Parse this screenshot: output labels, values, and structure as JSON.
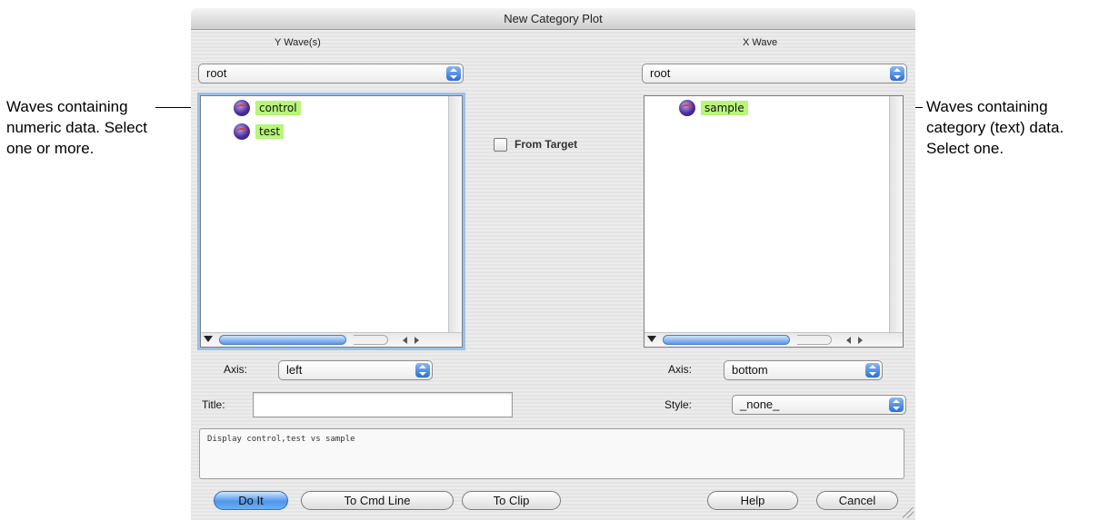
{
  "annotations": {
    "left_lines": [
      "Waves containing",
      "numeric data. Select",
      "one or more."
    ],
    "right_lines": [
      "Waves containing",
      "category (text) data.",
      "Select one."
    ]
  },
  "dialog": {
    "title": "New Category Plot",
    "y_panel": {
      "label": "Y Wave(s)",
      "folder": "root",
      "waves": [
        "control",
        "test"
      ],
      "axis_label": "Axis:",
      "axis_value": "left"
    },
    "x_panel": {
      "label": "X Wave",
      "folder": "root",
      "waves": [
        "sample"
      ],
      "axis_label": "Axis:",
      "axis_value": "bottom",
      "style_label": "Style:",
      "style_value": "_none_"
    },
    "from_target_label": "From Target",
    "title_label": "Title:",
    "title_value": "",
    "command_text": "Display control,test vs sample",
    "buttons": {
      "do_it": "Do It",
      "to_cmd_line": "To Cmd Line",
      "to_clip": "To Clip",
      "help": "Help",
      "cancel": "Cancel"
    }
  }
}
